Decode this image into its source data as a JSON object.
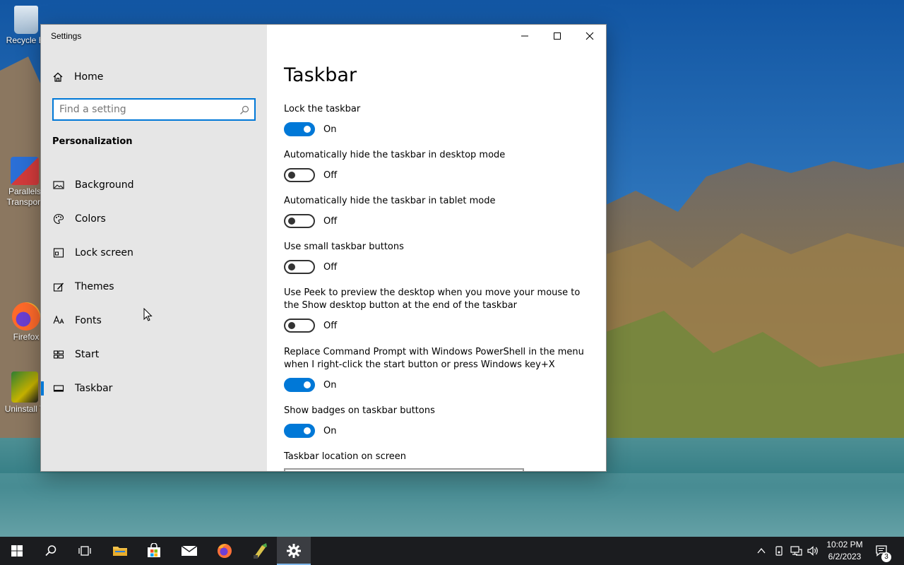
{
  "desktop": {
    "icons": [
      {
        "label": "Recycle Bi"
      },
      {
        "label": "Parallels Transport"
      },
      {
        "label": "Firefox"
      },
      {
        "label": "Uninstall T"
      }
    ]
  },
  "window": {
    "title": "Settings",
    "sidebar": {
      "home_label": "Home",
      "search_placeholder": "Find a setting",
      "section": "Personalization",
      "items": [
        {
          "label": "Background",
          "icon": "picture-icon"
        },
        {
          "label": "Colors",
          "icon": "palette-icon"
        },
        {
          "label": "Lock screen",
          "icon": "lock-screen-icon"
        },
        {
          "label": "Themes",
          "icon": "themes-icon"
        },
        {
          "label": "Fonts",
          "icon": "fonts-icon"
        },
        {
          "label": "Start",
          "icon": "start-icon"
        },
        {
          "label": "Taskbar",
          "icon": "taskbar-icon"
        }
      ],
      "active_item": "Taskbar"
    },
    "page_title": "Taskbar",
    "settings": [
      {
        "label": "Lock the taskbar",
        "state": "On",
        "on": true
      },
      {
        "label": "Automatically hide the taskbar in desktop mode",
        "state": "Off",
        "on": false
      },
      {
        "label": "Automatically hide the taskbar in tablet mode",
        "state": "Off",
        "on": false
      },
      {
        "label": "Use small taskbar buttons",
        "state": "Off",
        "on": false
      },
      {
        "label": "Use Peek to preview the desktop when you move your mouse to the Show desktop button at the end of the taskbar",
        "state": "Off",
        "on": false
      },
      {
        "label": "Replace Command Prompt with Windows PowerShell in the menu when I right-click the start button or press Windows key+X",
        "state": "On",
        "on": true
      },
      {
        "label": "Show badges on taskbar buttons",
        "state": "On",
        "on": true
      }
    ],
    "location_label": "Taskbar location on screen"
  },
  "taskbar": {
    "clock_time": "10:02 PM",
    "clock_date": "6/2/2023",
    "notification_count": "3"
  },
  "colors": {
    "accent": "#0078d7",
    "sidebar_bg": "#e6e6e6",
    "taskbar_bg": "#1b1c1f"
  }
}
